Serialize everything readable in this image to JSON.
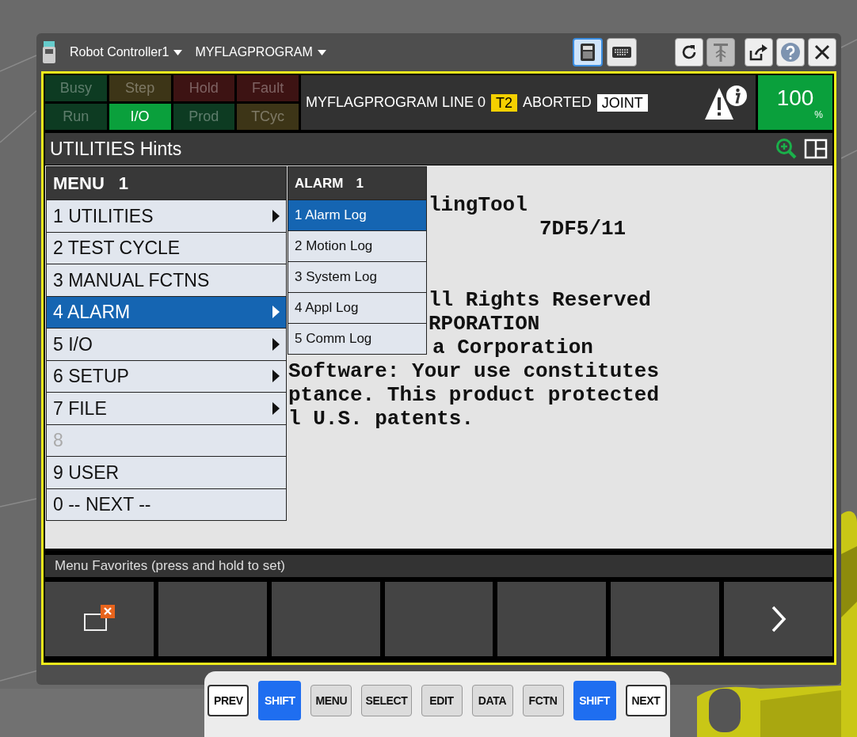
{
  "title_bar": {
    "controller": "Robot Controller1",
    "program": "MYFLAGPROGRAM",
    "view_buttons": [
      {
        "kind": "pendant",
        "selected": true
      },
      {
        "kind": "keyboard",
        "selected": false
      }
    ],
    "tool_buttons": [
      {
        "kind": "refresh",
        "disabled": false
      },
      {
        "kind": "jog",
        "disabled": true
      },
      {
        "kind": "export",
        "disabled": false
      },
      {
        "kind": "help",
        "disabled": false
      },
      {
        "kind": "close",
        "disabled": false
      }
    ]
  },
  "status_indicators": [
    {
      "label": "Busy",
      "color": "#0d3b22",
      "on": false
    },
    {
      "label": "Step",
      "color": "#3d3517",
      "on": false
    },
    {
      "label": "Hold",
      "color": "#3d1313",
      "on": false
    },
    {
      "label": "Fault",
      "color": "#3d1313",
      "on": false
    },
    {
      "label": "Run",
      "color": "#0d3b22",
      "on": false
    },
    {
      "label": "I/O",
      "color": "#0aa03c",
      "on": true
    },
    {
      "label": "Prod",
      "color": "#0d3b22",
      "on": false
    },
    {
      "label": "TCyc",
      "color": "#3d3517",
      "on": false
    }
  ],
  "program_status": {
    "program": "MYFLAGPROGRAM LINE 0",
    "mode": "T2",
    "state": "ABORTED",
    "coord": "JOINT"
  },
  "override": {
    "value": "100",
    "unit": "%"
  },
  "screen_title": "UTILITIES Hints",
  "content_lines": [
    "lingTool",
    "7DF5/11",
    "ll Rights Reserved",
    "RPORATION",
    "a Corporation",
    "Software: Your use constitutes",
    "ptance. This product protected",
    "l U.S. patents."
  ],
  "menu": {
    "title": "MENU",
    "page": "1",
    "items": [
      {
        "label": "1 UTILITIES",
        "selected": false,
        "has_submenu": true,
        "disabled": false
      },
      {
        "label": "2 TEST CYCLE",
        "selected": false,
        "has_submenu": false,
        "disabled": false
      },
      {
        "label": "3 MANUAL FCTNS",
        "selected": false,
        "has_submenu": false,
        "disabled": false
      },
      {
        "label": "4 ALARM",
        "selected": true,
        "has_submenu": true,
        "disabled": false
      },
      {
        "label": "5 I/O",
        "selected": false,
        "has_submenu": true,
        "disabled": false
      },
      {
        "label": "6 SETUP",
        "selected": false,
        "has_submenu": true,
        "disabled": false
      },
      {
        "label": "7 FILE",
        "selected": false,
        "has_submenu": true,
        "disabled": false
      },
      {
        "label": "8",
        "selected": false,
        "has_submenu": false,
        "disabled": true
      },
      {
        "label": "9 USER",
        "selected": false,
        "has_submenu": false,
        "disabled": false
      },
      {
        "label": "0 -- NEXT --",
        "selected": false,
        "has_submenu": false,
        "disabled": false
      }
    ]
  },
  "submenu": {
    "title": "ALARM",
    "page": "1",
    "items": [
      {
        "label": "1 Alarm Log",
        "selected": true
      },
      {
        "label": "2 Motion Log",
        "selected": false
      },
      {
        "label": "3 System Log",
        "selected": false
      },
      {
        "label": "4 Appl Log",
        "selected": false
      },
      {
        "label": "5 Comm Log",
        "selected": false
      }
    ]
  },
  "favorites": {
    "label": "Menu Favorites (press and hold to set)",
    "keys": [
      {
        "kind": "window"
      },
      {
        "kind": "empty"
      },
      {
        "kind": "empty"
      },
      {
        "kind": "empty"
      },
      {
        "kind": "empty"
      },
      {
        "kind": "empty"
      },
      {
        "kind": "next"
      }
    ]
  },
  "keypad": {
    "keys": [
      {
        "label": "PREV",
        "kind": "plain"
      },
      {
        "label": "SHIFT",
        "kind": "shift"
      },
      {
        "label": "MENU",
        "kind": "gray"
      },
      {
        "label": "SELECT",
        "kind": "gray"
      },
      {
        "label": "EDIT",
        "kind": "gray"
      },
      {
        "label": "DATA",
        "kind": "gray"
      },
      {
        "label": "FCTN",
        "kind": "gray"
      },
      {
        "label": "SHIFT",
        "kind": "shift"
      },
      {
        "label": "NEXT",
        "kind": "plain"
      }
    ]
  }
}
